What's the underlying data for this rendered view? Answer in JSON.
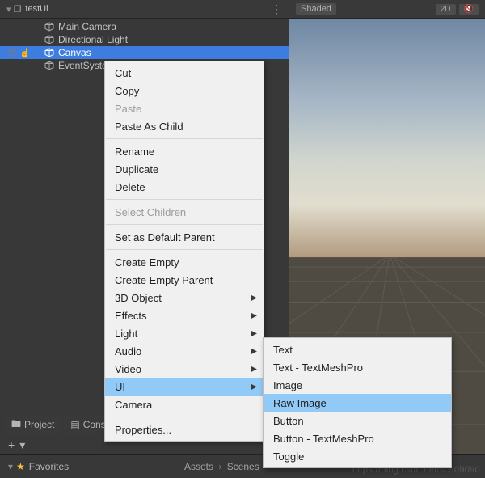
{
  "hierarchy": {
    "scene_name": "testUi",
    "items": [
      {
        "label": "Main Camera"
      },
      {
        "label": "Directional Light"
      },
      {
        "label": "Canvas"
      },
      {
        "label": "EventSystem"
      }
    ]
  },
  "scene_toolbar": {
    "shaded": "Shaded",
    "btn_2d": "2D",
    "btn_mute": "🔇"
  },
  "context_menu": {
    "cut": "Cut",
    "copy": "Copy",
    "paste": "Paste",
    "paste_as_child": "Paste As Child",
    "rename": "Rename",
    "duplicate": "Duplicate",
    "delete": "Delete",
    "select_children": "Select Children",
    "set_default_parent": "Set as Default Parent",
    "create_empty": "Create Empty",
    "create_empty_parent": "Create Empty Parent",
    "obj_3d": "3D Object",
    "effects": "Effects",
    "light": "Light",
    "audio": "Audio",
    "video": "Video",
    "ui": "UI",
    "camera": "Camera",
    "properties": "Properties..."
  },
  "ui_submenu": {
    "text": "Text",
    "text_tmp": "Text - TextMeshPro",
    "image": "Image",
    "raw_image": "Raw Image",
    "button": "Button",
    "button_tmp": "Button - TextMeshPro",
    "toggle": "Toggle"
  },
  "bottom": {
    "project": "Project",
    "console": "Console",
    "plus": "+",
    "favorites": "Favorites",
    "bc_assets": "Assets",
    "bc_scenes": "Scenes"
  },
  "watermark": "https://blog.csdn.net/sc909090"
}
